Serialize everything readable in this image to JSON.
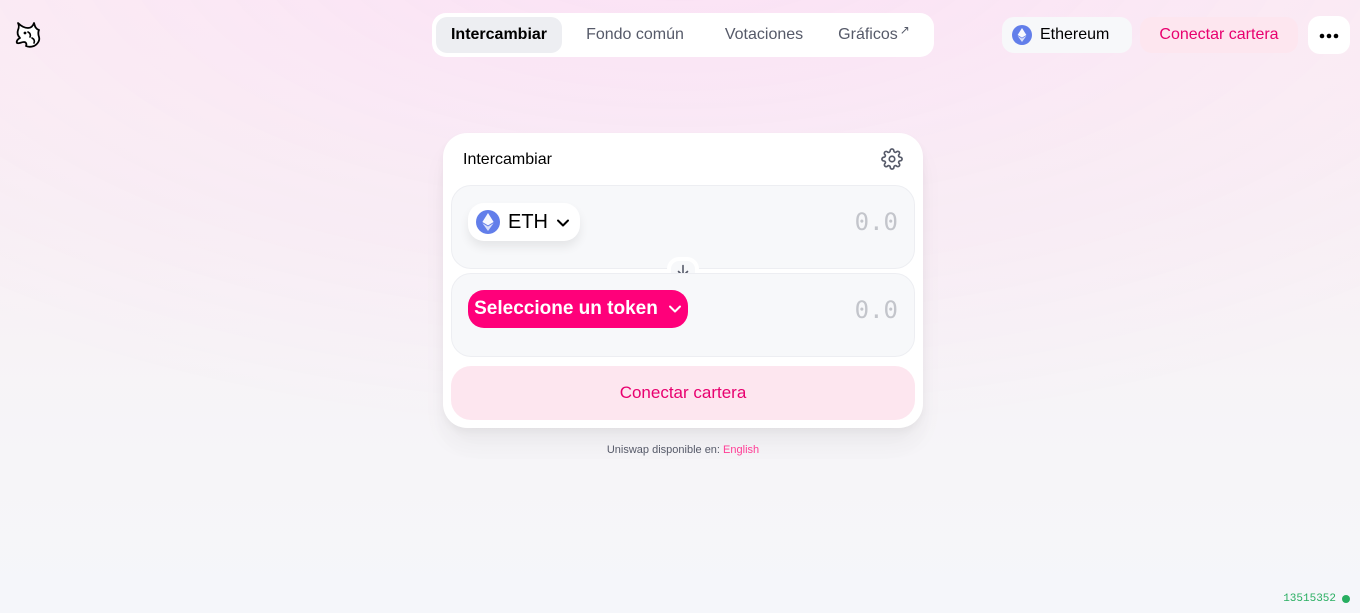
{
  "header": {
    "logo_icon": "uniswap-unicorn-icon",
    "nav": [
      {
        "label": "Intercambiar",
        "active": true
      },
      {
        "label": "Fondo común",
        "active": false
      },
      {
        "label": "Votaciones",
        "active": false
      },
      {
        "label": "Gráficos",
        "active": false,
        "external": "↗"
      }
    ],
    "network_label": "Ethereum",
    "connect_label": "Conectar cartera",
    "more_icon": "ellipsis-icon"
  },
  "swap": {
    "title": "Intercambiar",
    "settings_icon": "gear-icon",
    "input": {
      "token_symbol": "ETH",
      "placeholder": "0.0"
    },
    "output": {
      "select_label": "Seleccione un token",
      "placeholder": "0.0"
    },
    "switch_icon": "arrow-down-icon",
    "connect_label": "Conectar cartera"
  },
  "footer": {
    "lang_prefix": "Uniswap disponible en: ",
    "lang_link": "English",
    "block_number": "13515352"
  },
  "colors": {
    "accent": "#ff007a",
    "accent_text": "#e8006f",
    "accent_soft": "#fde6ef",
    "eth": "#627eea",
    "block_status": "#27ae60"
  }
}
